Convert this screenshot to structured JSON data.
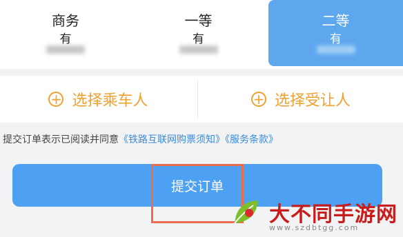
{
  "seats": [
    {
      "name": "商务",
      "availability": "有"
    },
    {
      "name": "一等",
      "availability": "有"
    },
    {
      "name": "二等",
      "availability": "有",
      "selected": true
    }
  ],
  "passengers": {
    "select_passenger": "选择乘车人",
    "select_beneficiary": "选择受让人"
  },
  "agreement": {
    "text": "提交订单表示已阅读并同意",
    "link1": "《铁路互联网购票须知》",
    "link2": "《服务条款》"
  },
  "submit_label": "提交订单",
  "watermark": {
    "title": "大不同手游网",
    "url": "www.szdbtgg.com"
  },
  "colors": {
    "accent": "#5ea7ef",
    "button": "#4ea0f2",
    "orange": "#f0a030",
    "highlight": "#ee6a4c",
    "link": "#3a8bdc"
  }
}
